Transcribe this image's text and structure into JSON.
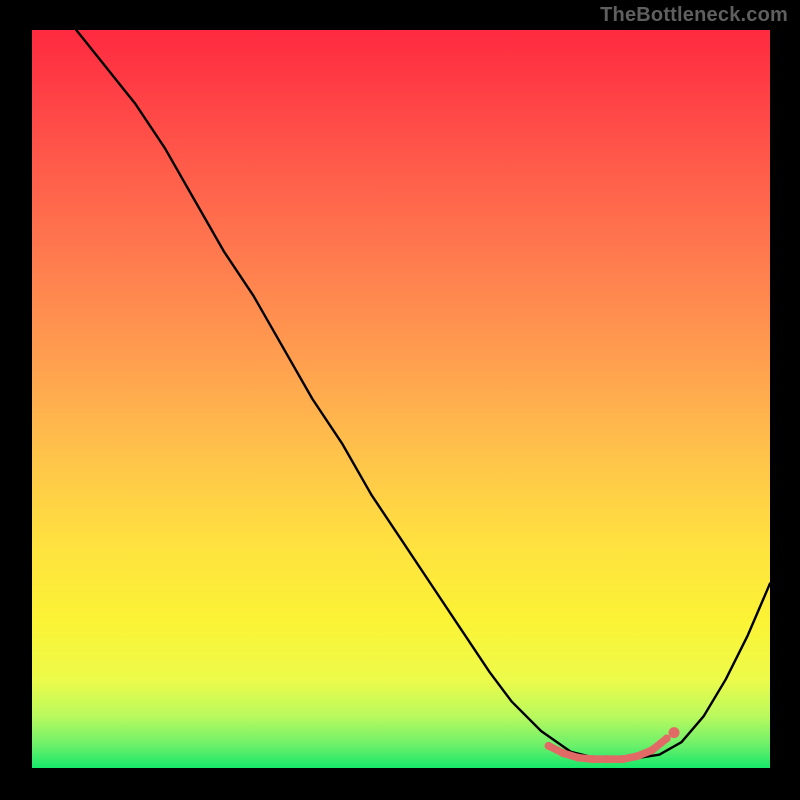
{
  "watermark": "TheBottleneck.com",
  "chart_data": {
    "type": "line",
    "title": "",
    "xlabel": "",
    "ylabel": "",
    "xlim": [
      0,
      100
    ],
    "ylim": [
      0,
      100
    ],
    "grid": false,
    "legend": false,
    "series": [
      {
        "name": "bottleneck-curve",
        "x": [
          6,
          10,
          14,
          18,
          22,
          26,
          30,
          34,
          38,
          42,
          46,
          50,
          54,
          58,
          62,
          65,
          69,
          73,
          77,
          81,
          85,
          88,
          91,
          94,
          97,
          100
        ],
        "y": [
          100,
          95,
          90,
          84,
          77,
          70,
          64,
          57,
          50,
          44,
          37,
          31,
          25,
          19,
          13,
          9,
          5,
          2.2,
          1.2,
          1.2,
          1.8,
          3.5,
          7,
          12,
          18,
          25
        ]
      }
    ],
    "markers": {
      "name": "optimal-zone",
      "x": [
        70,
        72,
        74,
        76,
        78,
        80,
        82,
        84,
        86
      ],
      "y": [
        3.0,
        2.0,
        1.4,
        1.2,
        1.2,
        1.2,
        1.6,
        2.4,
        4.0
      ]
    },
    "annotations": [
      {
        "name": "end-dot",
        "x": 87,
        "y": 4.8
      }
    ],
    "background_gradient": {
      "top": "#ff2a3f",
      "bottom": "#16e76a",
      "stops": [
        "red",
        "orange",
        "yellow",
        "green"
      ]
    }
  }
}
